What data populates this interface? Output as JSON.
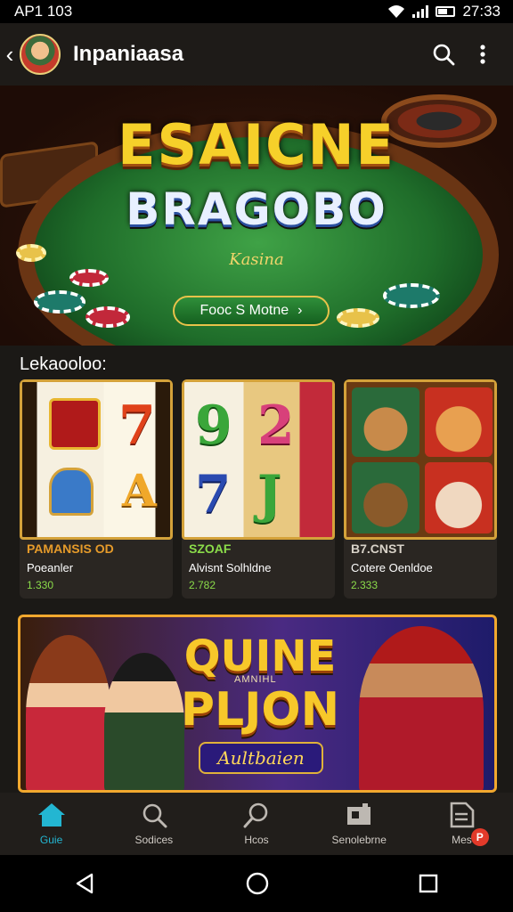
{
  "status_bar": {
    "left_text": "AP1 103",
    "time": "27:33"
  },
  "app_bar": {
    "title": "Inpaniaasa",
    "back_icon": "chevron-left-icon",
    "search_icon": "search-icon",
    "menu_icon": "more-vertical-icon"
  },
  "hero": {
    "title_line1": "ESAICNE",
    "title_line2": "BRAGOBO",
    "subtitle": "Kasina",
    "button_label": "Fooc S Motne",
    "button_arrow": "›"
  },
  "section": {
    "title": "Lekaooloo:"
  },
  "cards": [
    {
      "badge": "PAMANSIS OD",
      "name": "Poeanler",
      "count": "1.330",
      "badge_color": "#e69b2a"
    },
    {
      "badge": "SZOAF",
      "name": "Alvisnt Solhldne",
      "count": "2.782",
      "badge_color": "#8bdc4a"
    },
    {
      "badge": "B7.CNST",
      "name": "Cotere Oenldoe",
      "count": "2.333",
      "badge_color": "#d8d2c8"
    }
  ],
  "promo": {
    "title_line1": "QUINE",
    "title_line2": "PLJON",
    "small_text": "AMNIHL",
    "subtitle": "Aultbaien"
  },
  "bottom_nav": [
    {
      "label": "Guie",
      "icon": "home-icon",
      "active": true
    },
    {
      "label": "Sodices",
      "icon": "search-icon",
      "active": false
    },
    {
      "label": "Hcos",
      "icon": "magnifier-icon",
      "active": false
    },
    {
      "label": "Senolebrne",
      "icon": "puzzle-icon",
      "active": false
    },
    {
      "label": "Mes",
      "icon": "document-icon",
      "active": false,
      "badge": "P"
    }
  ],
  "system_nav": {
    "back": "back-triangle-icon",
    "home": "home-circle-icon",
    "recents": "recents-square-icon"
  },
  "colors": {
    "accent": "#23b6d2",
    "gold": "#d4a23a",
    "green": "#2f8f3a"
  }
}
